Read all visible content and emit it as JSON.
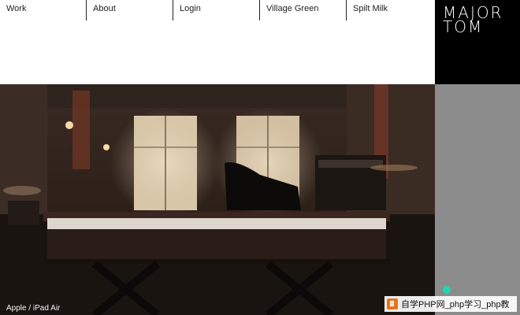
{
  "nav": {
    "items": [
      {
        "label": "Work"
      },
      {
        "label": "About"
      },
      {
        "label": "Login"
      },
      {
        "label": "Village Green"
      },
      {
        "label": "Spilt Milk"
      }
    ]
  },
  "logo": {
    "line1": "MAJOR",
    "line2": "TOM"
  },
  "hero": {
    "caption": "Apple / iPad Air"
  },
  "watermark": {
    "text": "自学PHP网_php学习_php教"
  },
  "colors": {
    "accent": "#20d6b2",
    "logo_bg": "#000000",
    "side_panel": "#8c8c8c"
  }
}
